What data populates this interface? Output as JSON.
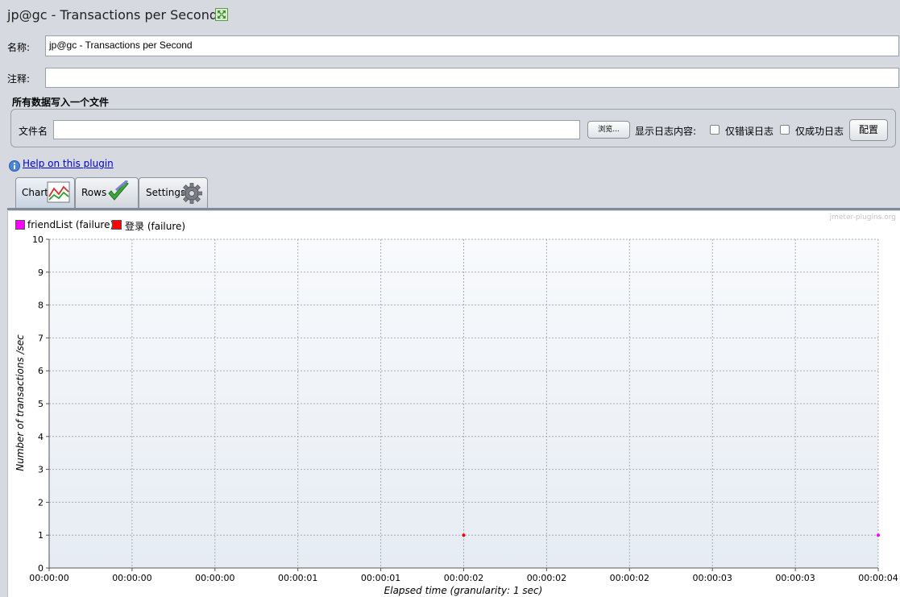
{
  "window": {
    "title": "jp@gc - Transactions per Second",
    "expand_icon": "expand-arrows-icon"
  },
  "form": {
    "name_label": "名称:",
    "name_value": "jp@gc - Transactions per Second",
    "comment_label": "注释:",
    "comment_value": ""
  },
  "file_section": {
    "title": "所有数据写入一个文件",
    "filename_label": "文件名",
    "filename_value": "",
    "browse_button": "浏览...",
    "log_display_label": "显示日志内容:",
    "errors_only_label": "仅错误日志",
    "errors_only_checked": false,
    "success_only_label": "仅成功日志",
    "success_only_checked": false,
    "configure_button": "配置"
  },
  "help": {
    "icon": "info-icon",
    "link_text": "Help on this plugin"
  },
  "tabs": [
    {
      "label": "Chart",
      "icon": "line-chart-icon",
      "active": true
    },
    {
      "label": "Rows",
      "icon": "checkmark-icon",
      "active": false
    },
    {
      "label": "Settings",
      "icon": "gear-icon",
      "active": false
    }
  ],
  "chart_data": {
    "type": "scatter",
    "watermark": "jmeter-plugins.org",
    "xlabel": "Elapsed time (granularity: 1 sec)",
    "ylabel": "Number of transactions /sec",
    "ylim": [
      0,
      10
    ],
    "yticks": [
      "0",
      "1",
      "2",
      "3",
      "4",
      "5",
      "6",
      "7",
      "8",
      "9",
      "10"
    ],
    "xticks": [
      "00:00:00",
      "00:00:00",
      "00:00:00",
      "00:00:01",
      "00:00:01",
      "00:00:02",
      "00:00:02",
      "00:00:02",
      "00:00:03",
      "00:00:03",
      "00:00:04"
    ],
    "grid": true,
    "legend_placement": "top-left",
    "series": [
      {
        "name": "friendList (failure)",
        "color": "#ff00ff",
        "points": [
          {
            "x_tick_index": 10,
            "y": 1
          }
        ]
      },
      {
        "name": "登录 (failure)",
        "color": "#ff0000",
        "points": [
          {
            "x_tick_index": 5,
            "y": 1
          }
        ]
      }
    ]
  }
}
